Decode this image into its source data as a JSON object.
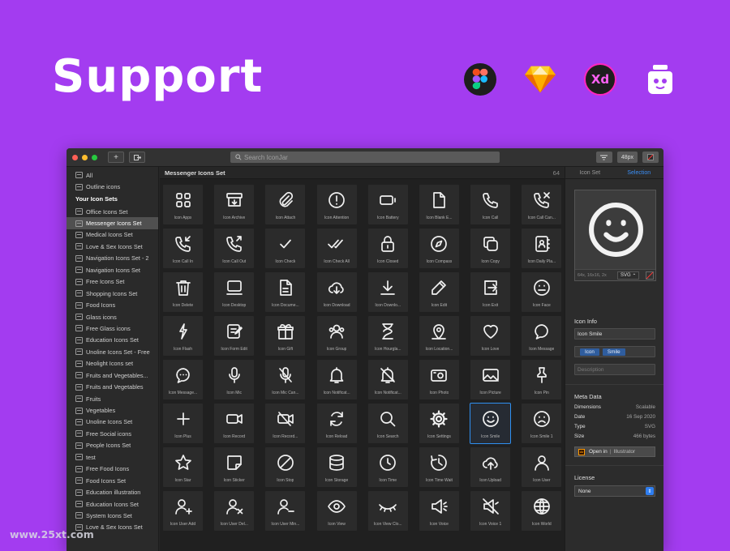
{
  "headline": "Support",
  "tools": [
    {
      "name": "figma-icon"
    },
    {
      "name": "sketch-icon"
    },
    {
      "name": "adobe-xd-icon",
      "text": "Xd"
    },
    {
      "name": "iconjar-icon"
    }
  ],
  "toolbar": {
    "add_label": "+",
    "search_placeholder": "Search IconJar",
    "size_label": "48px"
  },
  "sidebar": {
    "top_items": [
      "All",
      "Outline icons"
    ],
    "section_title": "Your Icon Sets",
    "sets": [
      "Office Icons Set",
      "Messenger Icons Set",
      "Medical Icons Set",
      "Love & Sex Icons Set",
      "Navigation Icons Set - 2",
      "Navigation Icons Set",
      "Free Icons Set",
      "Shopping Icons Set",
      "Food Icons",
      "Glass icons",
      "Free Glass icons",
      "Education Icons Set",
      "Unoline Icons Set - Free",
      "Neolight Icons set",
      "Fruits and Vegetables...",
      "Fruits and Vegetables",
      "Fruits",
      "Vegetables",
      "Unoline Icons Set",
      "Free Social icons",
      "People Icons Set",
      "test",
      "Free Food Icons",
      "Food Icons Set",
      "Education illustration",
      "Education Icons Set",
      "System Icons Set",
      "Love & Sex Icons Set"
    ],
    "selected_index": 1
  },
  "main": {
    "title": "Messenger Icons Set",
    "count": "64",
    "icons": [
      {
        "label": "Icon Apps",
        "icon": "apps"
      },
      {
        "label": "Icon Archive",
        "icon": "archive"
      },
      {
        "label": "Icon Attach",
        "icon": "attach"
      },
      {
        "label": "Icon Attention",
        "icon": "attention"
      },
      {
        "label": "Icon Battery",
        "icon": "battery"
      },
      {
        "label": "Icon Blank E...",
        "icon": "blank"
      },
      {
        "label": "Icon Call",
        "icon": "call"
      },
      {
        "label": "Icon Call Can...",
        "icon": "call-cancel"
      },
      {
        "label": "Icon Call In",
        "icon": "call-in"
      },
      {
        "label": "Icon Call Out",
        "icon": "call-out"
      },
      {
        "label": "Icon Check",
        "icon": "check"
      },
      {
        "label": "Icon Check All",
        "icon": "check-all"
      },
      {
        "label": "Icon Closed",
        "icon": "closed"
      },
      {
        "label": "Icon Compass",
        "icon": "compass"
      },
      {
        "label": "Icon Copy",
        "icon": "copy"
      },
      {
        "label": "Icon Daily Pla...",
        "icon": "daily"
      },
      {
        "label": "Icon Delete",
        "icon": "delete"
      },
      {
        "label": "Icon Desktop",
        "icon": "desktop"
      },
      {
        "label": "Icon Docume...",
        "icon": "document"
      },
      {
        "label": "Icon Download",
        "icon": "cloud-download"
      },
      {
        "label": "Icon Downlo...",
        "icon": "download"
      },
      {
        "label": "Icon Edit",
        "icon": "edit"
      },
      {
        "label": "Icon Exit",
        "icon": "exit"
      },
      {
        "label": "Icon Face",
        "icon": "face"
      },
      {
        "label": "Icon Flash",
        "icon": "flash"
      },
      {
        "label": "Icon Form Edit",
        "icon": "form-edit"
      },
      {
        "label": "Icon Gift",
        "icon": "gift"
      },
      {
        "label": "Icon Group",
        "icon": "group"
      },
      {
        "label": "Icon Hourgla...",
        "icon": "hourglass"
      },
      {
        "label": "Icon Location...",
        "icon": "location"
      },
      {
        "label": "Icon Love",
        "icon": "love"
      },
      {
        "label": "Icon Message",
        "icon": "message"
      },
      {
        "label": "Icon Message...",
        "icon": "message-dots"
      },
      {
        "label": "Icon Mic",
        "icon": "mic"
      },
      {
        "label": "Icon Mic Can...",
        "icon": "mic-cancel"
      },
      {
        "label": "Icon Notificat...",
        "icon": "bell"
      },
      {
        "label": "Icon Notificat...",
        "icon": "bell-off"
      },
      {
        "label": "Icon Photo",
        "icon": "photo"
      },
      {
        "label": "Icon Picture",
        "icon": "picture"
      },
      {
        "label": "Icon Pin",
        "icon": "pin"
      },
      {
        "label": "Icon Plus",
        "icon": "plus"
      },
      {
        "label": "Icon Record",
        "icon": "record"
      },
      {
        "label": "Icon Record...",
        "icon": "record-off"
      },
      {
        "label": "Icon Reload",
        "icon": "reload"
      },
      {
        "label": "Icon Search",
        "icon": "search"
      },
      {
        "label": "Icon Settings",
        "icon": "settings"
      },
      {
        "label": "Icon Smile",
        "icon": "smile"
      },
      {
        "label": "Icon Smile 1",
        "icon": "sad"
      },
      {
        "label": "Icon Star",
        "icon": "star"
      },
      {
        "label": "Icon Sticker",
        "icon": "sticker"
      },
      {
        "label": "Icon Stop",
        "icon": "stop"
      },
      {
        "label": "Icon Storage",
        "icon": "storage"
      },
      {
        "label": "Icon Time",
        "icon": "time"
      },
      {
        "label": "Icon Time Wait",
        "icon": "time-wait"
      },
      {
        "label": "Icon Upload",
        "icon": "upload"
      },
      {
        "label": "Icon User",
        "icon": "user"
      },
      {
        "label": "Icon User Add",
        "icon": "user-add"
      },
      {
        "label": "Icon User Del...",
        "icon": "user-delete"
      },
      {
        "label": "Icon User Min...",
        "icon": "user-minus"
      },
      {
        "label": "Icon View",
        "icon": "view"
      },
      {
        "label": "Icon View Clo...",
        "icon": "view-closed"
      },
      {
        "label": "Icon Voice",
        "icon": "voice"
      },
      {
        "label": "Icon Voice 1",
        "icon": "voice-off"
      },
      {
        "label": "Icon World",
        "icon": "world"
      }
    ],
    "selected_index": 46
  },
  "panel": {
    "tabs": [
      "Icon Set",
      "Selection"
    ],
    "active_tab": 1,
    "preview_sizes": "64x, 16x16, 2x",
    "preview_format": "SVG",
    "info_title": "Icon Info",
    "name_value": "Icon Smile",
    "tags": [
      "Icon",
      "Smile"
    ],
    "description_placeholder": "Description",
    "meta_title": "Meta Data",
    "meta": [
      {
        "key": "Dimensions",
        "value": "Scalable"
      },
      {
        "key": "Date",
        "value": "16 Sep 2020"
      },
      {
        "key": "Type",
        "value": "SVG"
      },
      {
        "key": "Size",
        "value": "466 bytes"
      }
    ],
    "open_in_label": "Open in",
    "open_in_app": "Illustrator",
    "license_title": "License",
    "license_value": "None"
  },
  "watermark": "www.25xt.com",
  "colors": {
    "background": "#a33cf0",
    "accent": "#2f8ff0",
    "tag": "#2f5d9e"
  }
}
